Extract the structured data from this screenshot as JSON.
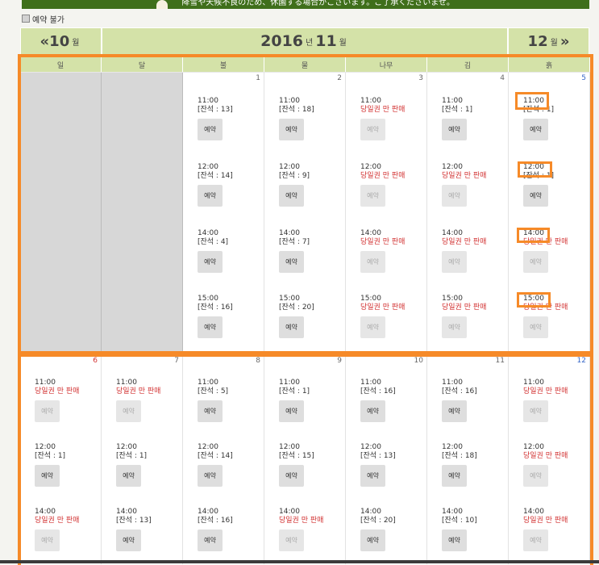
{
  "banner": {
    "text": "降雪や天候不良のため、休園する場合がございます。ご了承くださいませ。"
  },
  "legend": {
    "label": "예약 불가"
  },
  "nav": {
    "prev": "«10",
    "prev_unit": "월",
    "year": "2016",
    "year_unit": "년",
    "month": "11",
    "month_unit": "월",
    "next": "12",
    "next_unit": "월",
    "next_arrow": "»"
  },
  "headers": [
    "일",
    "달",
    "불",
    "물",
    "나무",
    "김",
    "흙"
  ],
  "weeks": [
    [
      {
        "empty": true
      },
      {
        "empty": true
      },
      {
        "day": "1",
        "slots": [
          {
            "time": "11:00",
            "status": "[잔석 : 13]",
            "button": "예약",
            "closed": false
          },
          {
            "time": "12:00",
            "status": "[잔석 : 14]",
            "button": "예약",
            "closed": false
          },
          {
            "time": "14:00",
            "status": "[잔석 : 4]",
            "button": "예약",
            "closed": false
          },
          {
            "time": "15:00",
            "status": "[잔석 : 16]",
            "button": "예약",
            "closed": false
          }
        ]
      },
      {
        "day": "2",
        "slots": [
          {
            "time": "11:00",
            "status": "[잔석 : 18]",
            "button": "예약",
            "closed": false
          },
          {
            "time": "12:00",
            "status": "[잔석 : 9]",
            "button": "예약",
            "closed": false
          },
          {
            "time": "14:00",
            "status": "[잔석 : 7]",
            "button": "예약",
            "closed": false
          },
          {
            "time": "15:00",
            "status": "[잔석 : 20]",
            "button": "예약",
            "closed": false
          }
        ]
      },
      {
        "day": "3",
        "slots": [
          {
            "time": "11:00",
            "status": "당일권 만 판매",
            "button": "예약",
            "closed": true
          },
          {
            "time": "12:00",
            "status": "당일권 만 판매",
            "button": "예약",
            "closed": true
          },
          {
            "time": "14:00",
            "status": "당일권 만 판매",
            "button": "예약",
            "closed": true
          },
          {
            "time": "15:00",
            "status": "당일권 만 판매",
            "button": "예약",
            "closed": true
          }
        ]
      },
      {
        "day": "4",
        "slots": [
          {
            "time": "11:00",
            "status": "[잔석 : 1]",
            "button": "예약",
            "closed": false
          },
          {
            "time": "12:00",
            "status": "당일권 만 판매",
            "button": "예약",
            "closed": true
          },
          {
            "time": "14:00",
            "status": "당일권 만 판매",
            "button": "예약",
            "closed": true
          },
          {
            "time": "15:00",
            "status": "당일권 만 판매",
            "button": "예약",
            "closed": true
          }
        ]
      },
      {
        "day": "5",
        "slots": [
          {
            "time": "11:00",
            "status": "[잔석 : 1]",
            "button": "예약",
            "closed": false
          },
          {
            "time": "12:00",
            "status": "[잔석 : 1]",
            "button": "예약",
            "closed": false
          },
          {
            "time": "14:00",
            "status": "당일권 만 판매",
            "button": "예약",
            "closed": true
          },
          {
            "time": "15:00",
            "status": "당일권 만 판매",
            "button": "예약",
            "closed": true
          }
        ]
      }
    ],
    [
      {
        "day": "6",
        "slots": [
          {
            "time": "11:00",
            "status": "당일권 만 판매",
            "button": "예약",
            "closed": true
          },
          {
            "time": "12:00",
            "status": "[잔석 : 1]",
            "button": "예약",
            "closed": false
          },
          {
            "time": "14:00",
            "status": "당일권 만 판매",
            "button": "예약",
            "closed": true
          }
        ]
      },
      {
        "day": "7",
        "slots": [
          {
            "time": "11:00",
            "status": "당일권 만 판매",
            "button": "예약",
            "closed": true
          },
          {
            "time": "12:00",
            "status": "[잔석 : 1]",
            "button": "예약",
            "closed": false
          },
          {
            "time": "14:00",
            "status": "[잔석 : 13]",
            "button": "예약",
            "closed": false
          }
        ]
      },
      {
        "day": "8",
        "slots": [
          {
            "time": "11:00",
            "status": "[잔석 : 5]",
            "button": "예약",
            "closed": false
          },
          {
            "time": "12:00",
            "status": "[잔석 : 14]",
            "button": "예약",
            "closed": false
          },
          {
            "time": "14:00",
            "status": "[잔석 : 16]",
            "button": "예약",
            "closed": false
          }
        ]
      },
      {
        "day": "9",
        "slots": [
          {
            "time": "11:00",
            "status": "[잔석 : 1]",
            "button": "예약",
            "closed": false
          },
          {
            "time": "12:00",
            "status": "[잔석 : 15]",
            "button": "예약",
            "closed": false
          },
          {
            "time": "14:00",
            "status": "당일권 만 판매",
            "button": "예약",
            "closed": true
          }
        ]
      },
      {
        "day": "10",
        "slots": [
          {
            "time": "11:00",
            "status": "[잔석 : 16]",
            "button": "예약",
            "closed": false
          },
          {
            "time": "12:00",
            "status": "[잔석 : 13]",
            "button": "예약",
            "closed": false
          },
          {
            "time": "14:00",
            "status": "[잔석 : 20]",
            "button": "예약",
            "closed": false
          }
        ]
      },
      {
        "day": "11",
        "slots": [
          {
            "time": "11:00",
            "status": "[잔석 : 16]",
            "button": "예약",
            "closed": false
          },
          {
            "time": "12:00",
            "status": "[잔석 : 18]",
            "button": "예약",
            "closed": false
          },
          {
            "time": "14:00",
            "status": "[잔석 : 10]",
            "button": "예약",
            "closed": false
          }
        ]
      },
      {
        "day": "12",
        "slots": [
          {
            "time": "11:00",
            "status": "당일권 만 판매",
            "button": "예약",
            "closed": true
          },
          {
            "time": "12:00",
            "status": "당일권 만 판매",
            "button": "예약",
            "closed": true
          },
          {
            "time": "14:00",
            "status": "당일권 만 판매",
            "button": "예약",
            "closed": true
          }
        ]
      }
    ]
  ],
  "colors": {
    "accent_orange": "#f68a28",
    "header_green": "#d4e2a8",
    "banner_green": "#3f6f1b",
    "sunday_red": "#d23030",
    "saturday_blue": "#3767c8"
  }
}
